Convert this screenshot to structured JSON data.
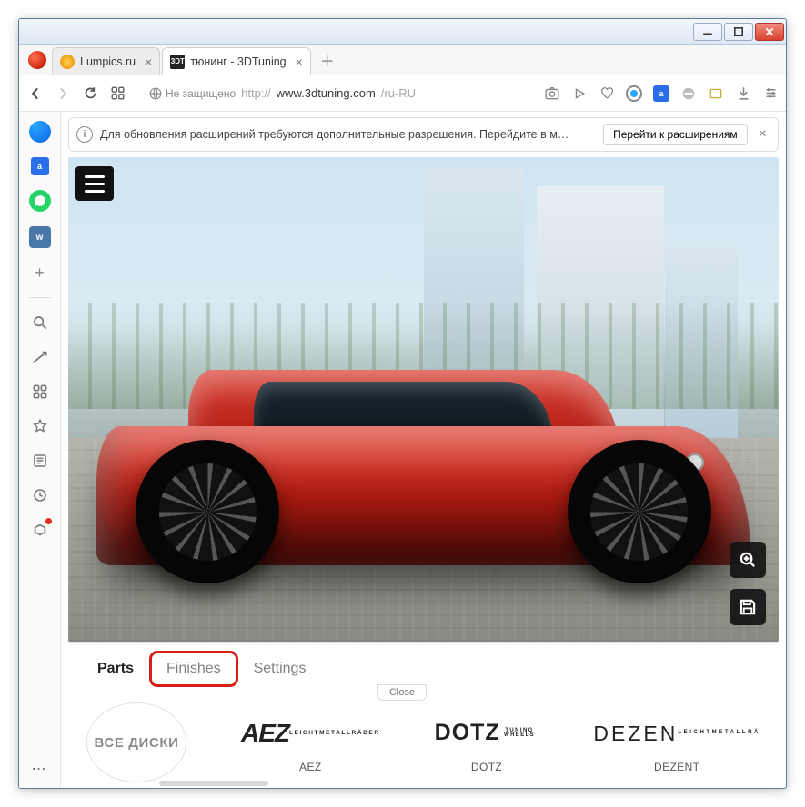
{
  "window": {
    "tabs": [
      {
        "title": "Lumpics.ru",
        "active": false
      },
      {
        "title": "тюнинг - 3DTuning",
        "active": true
      }
    ]
  },
  "urlbar": {
    "security_label": "Не защищено",
    "scheme": "http://",
    "host": "www.3dtuning.com",
    "path": "/ru-RU"
  },
  "infobar": {
    "message": "Для обновления расширений требуются дополнительные разрешения. Перейдите в м…",
    "action": "Перейти к расширениям"
  },
  "sidebar": {
    "vk_label": "w"
  },
  "viewer": {
    "badge": "3DT"
  },
  "panel": {
    "tabs": [
      {
        "id": "parts",
        "label": "Parts",
        "active": true
      },
      {
        "id": "finishes",
        "label": "Finishes",
        "highlighted": true
      },
      {
        "id": "settings",
        "label": "Settings"
      }
    ],
    "close_label": "Close",
    "all_wheels_label": "ВСЕ ДИСКИ",
    "brands": [
      {
        "logo_main": "AEZ",
        "logo_sub": "LEICHTMETALLRÄDER",
        "name": "AEZ"
      },
      {
        "logo_main": "DOTZ",
        "logo_sub": "TUNING WHEELS",
        "name": "DOTZ"
      },
      {
        "logo_main": "DEZEN",
        "logo_sub": "LEICHTMETALLRÄ",
        "name": "DEZENT"
      }
    ]
  }
}
